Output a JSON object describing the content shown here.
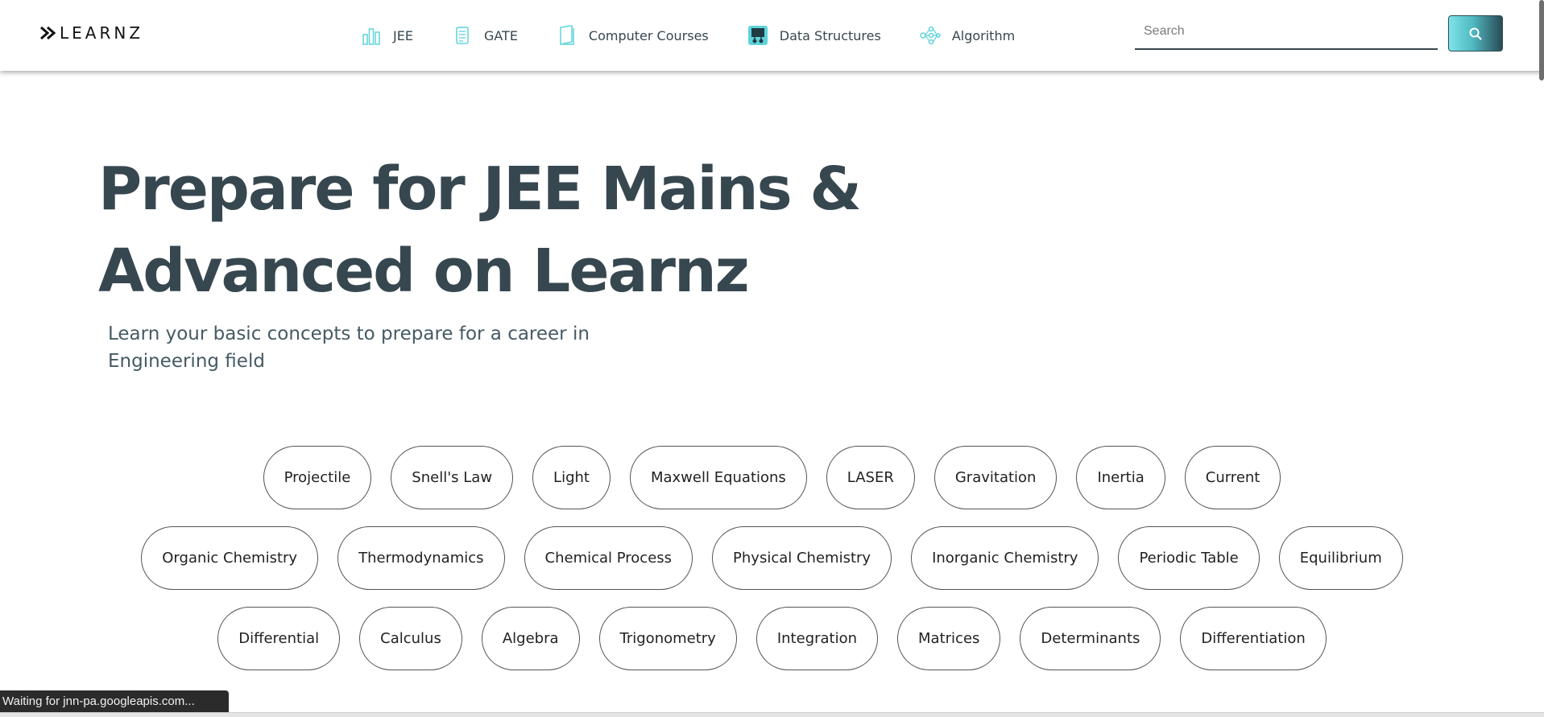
{
  "brand": {
    "logo_text": "LEARNZ"
  },
  "nav": {
    "items": [
      {
        "label": "JEE",
        "icon": "bar-chart-icon"
      },
      {
        "label": "GATE",
        "icon": "document-icon"
      },
      {
        "label": "Computer Courses",
        "icon": "book-icon"
      },
      {
        "label": "Data Structures",
        "icon": "data-structure-icon"
      },
      {
        "label": "Algorithm",
        "icon": "algorithm-icon"
      }
    ]
  },
  "search": {
    "placeholder": "Search",
    "value": "",
    "button_icon": "search-icon"
  },
  "hero": {
    "title": "Prepare for JEE Mains & Advanced on Learnz",
    "subtitle": "Learn your basic concepts to prepare for a career in Engineering field"
  },
  "topics": {
    "row1": [
      "Projectile",
      "Snell's Law",
      "Light",
      "Maxwell Equations",
      "LASER",
      "Gravitation",
      "Inertia",
      "Current"
    ],
    "row2": [
      "Organic Chemistry",
      "Thermodynamics",
      "Chemical Process",
      "Physical Chemistry",
      "Inorganic Chemistry",
      "Periodic Table",
      "Equilibrium"
    ],
    "row3": [
      "Differential",
      "Calculus",
      "Algebra",
      "Trigonometry",
      "Integration",
      "Matrices",
      "Determinants",
      "Differentiation"
    ]
  },
  "status_bar": {
    "text": "Waiting for jnn-pa.googleapis.com..."
  },
  "colors": {
    "accent": "#4fb8c0",
    "text_dark": "#37474f",
    "icon": "#5fd3dc"
  }
}
